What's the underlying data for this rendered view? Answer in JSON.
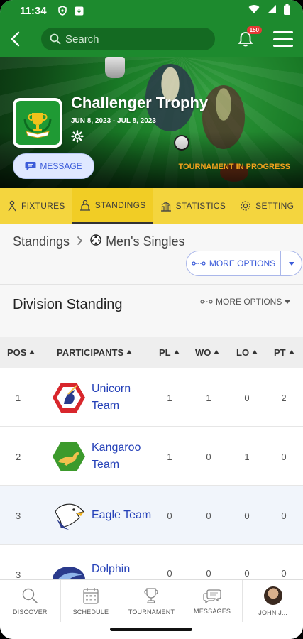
{
  "status_bar": {
    "time": "11:34"
  },
  "header": {
    "search_placeholder": "Search",
    "notification_count": "150"
  },
  "tournament": {
    "title": "Challenger Trophy",
    "dates": "JUN 8, 2023 - JUL 8, 2023",
    "message_label": "MESSAGE",
    "status": "TOURNAMENT IN PROGRESS"
  },
  "tabs": [
    {
      "label": "FIXTURES"
    },
    {
      "label": "STANDINGS"
    },
    {
      "label": "STATISTICS"
    },
    {
      "label": "SETTING"
    }
  ],
  "breadcrumb": {
    "root": "Standings",
    "current": "Men's Singles"
  },
  "more_options_label": "MORE OPTIONS",
  "division": {
    "title": "Division Standing",
    "more_options": "MORE OPTIONS"
  },
  "table": {
    "headers": [
      "POS",
      "PARTICIPANTS",
      "PL",
      "WO",
      "LO",
      "PT"
    ],
    "rows": [
      {
        "pos": "1",
        "name": "Unicorn Team",
        "pl": "1",
        "wo": "1",
        "lo": "0",
        "pt": "2"
      },
      {
        "pos": "2",
        "name": "Kangaroo Team",
        "pl": "1",
        "wo": "0",
        "lo": "1",
        "pt": "0"
      },
      {
        "pos": "3",
        "name": "Eagle Team",
        "pl": "0",
        "wo": "0",
        "lo": "0",
        "pt": "0"
      },
      {
        "pos": "3",
        "name": "Dolphin",
        "pl": "0",
        "wo": "0",
        "lo": "0",
        "pt": "0"
      }
    ]
  },
  "bottom_nav": [
    {
      "label": "DISCOVER"
    },
    {
      "label": "SCHEDULE"
    },
    {
      "label": "TOURNAMENT"
    },
    {
      "label": "MESSAGES"
    },
    {
      "label": "JOHN J..."
    }
  ],
  "colors": {
    "brand_green": "#1d8a2e",
    "tab_yellow": "#f4d53e",
    "link_blue": "#2541b8",
    "status_orange": "#f2a21c"
  }
}
